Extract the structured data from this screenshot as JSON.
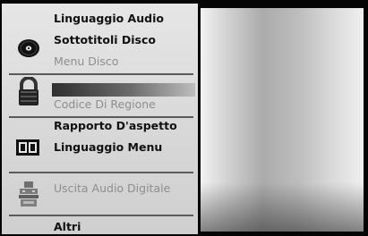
{
  "menu": {
    "items": [
      {
        "label": "Linguaggio Audio",
        "enabled": true
      },
      {
        "label": "Sottotitoli Disco",
        "enabled": true
      },
      {
        "label": "Menu Disco",
        "enabled": false
      },
      {
        "label": "",
        "enabled": true
      },
      {
        "label": "Codice Di Regione",
        "enabled": false
      },
      {
        "label": "Rapporto D'aspetto",
        "enabled": true
      },
      {
        "label": "Linguaggio Menu",
        "enabled": true
      },
      {
        "label": "Uscita Audio Digitale",
        "enabled": false
      },
      {
        "label": "Altri",
        "enabled": true
      }
    ],
    "icons": [
      "disc-icon",
      "lock-icon",
      "display-icon",
      "speaker-icon"
    ]
  }
}
